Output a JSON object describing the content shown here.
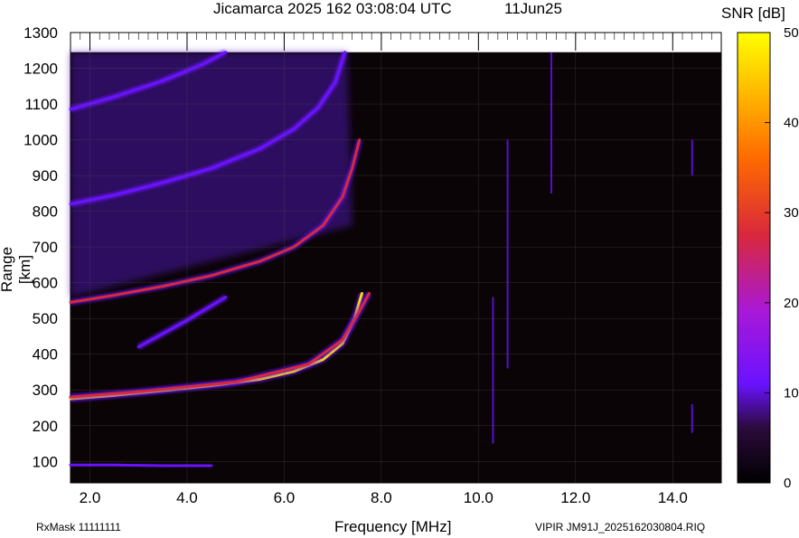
{
  "header": {
    "title": "Jicamarca 2025 162 03:08:04 UTC",
    "date": "11Jun25",
    "colorbar_title": "SNR [dB]"
  },
  "footer": {
    "rxmask": "RxMask 11111111",
    "file": "VIPIR  JM91J_2025162030804.RIQ"
  },
  "colors": {
    "background": "#0b0406",
    "trace_low": "#6a12ff",
    "trace_mid": "#d8283c",
    "trace_high": "#ffe000"
  },
  "chart_data": {
    "type": "heatmap",
    "xlabel": "Frequency [MHz]",
    "ylabel": "Range [km]",
    "xlim": [
      1.6,
      15.0
    ],
    "ylim": [
      40,
      1300
    ],
    "x_ticks": [
      "2.0",
      "4.0",
      "6.0",
      "8.0",
      "10.0",
      "12.0",
      "14.0"
    ],
    "y_ticks": [
      "100",
      "200",
      "300",
      "400",
      "500",
      "600",
      "700",
      "800",
      "900",
      "1000",
      "1100",
      "1200",
      "1300"
    ],
    "data_range_max": 1245,
    "colorbar": {
      "min": 0,
      "max": 50,
      "ticks": [
        "0",
        "10",
        "20",
        "30",
        "40",
        "50"
      ],
      "unit": "dB"
    },
    "traces": [
      {
        "points": [
          [
            1.6,
            275
          ],
          [
            2.5,
            285
          ],
          [
            3.5,
            298
          ],
          [
            4.5,
            312
          ],
          [
            5.5,
            330
          ],
          [
            6.2,
            352
          ],
          [
            6.8,
            385
          ],
          [
            7.2,
            430
          ],
          [
            7.45,
            500
          ],
          [
            7.6,
            570
          ]
        ],
        "snr": 38
      },
      {
        "points": [
          [
            1.6,
            280
          ],
          [
            3.0,
            295
          ],
          [
            5.0,
            322
          ],
          [
            6.5,
            372
          ],
          [
            7.2,
            440
          ],
          [
            7.55,
            520
          ],
          [
            7.75,
            570
          ]
        ],
        "snr": 25
      },
      {
        "points": [
          [
            1.6,
            545
          ],
          [
            2.5,
            565
          ],
          [
            3.5,
            590
          ],
          [
            4.5,
            620
          ],
          [
            5.5,
            660
          ],
          [
            6.2,
            700
          ],
          [
            6.8,
            760
          ],
          [
            7.2,
            840
          ],
          [
            7.4,
            920
          ],
          [
            7.55,
            1000
          ]
        ],
        "snr": 30
      },
      {
        "points": [
          [
            1.6,
            820
          ],
          [
            2.5,
            845
          ],
          [
            3.5,
            880
          ],
          [
            4.5,
            920
          ],
          [
            5.5,
            975
          ],
          [
            6.2,
            1030
          ],
          [
            6.7,
            1090
          ],
          [
            7.05,
            1160
          ],
          [
            7.25,
            1245
          ]
        ],
        "snr": 22
      },
      {
        "points": [
          [
            1.6,
            1085
          ],
          [
            2.5,
            1120
          ],
          [
            3.5,
            1165
          ],
          [
            4.3,
            1210
          ],
          [
            4.8,
            1245
          ]
        ],
        "snr": 20
      },
      {
        "points": [
          [
            3.0,
            420
          ],
          [
            4.0,
            495
          ],
          [
            4.8,
            560
          ]
        ],
        "snr": 12
      },
      {
        "points": [
          [
            1.6,
            90
          ],
          [
            2.5,
            90
          ],
          [
            3.5,
            88
          ],
          [
            4.5,
            88
          ]
        ],
        "snr": 12
      }
    ],
    "vertical_lines": [
      {
        "x": 10.3,
        "y": [
          150,
          560
        ],
        "snr": 14
      },
      {
        "x": 11.5,
        "y": [
          850,
          1245
        ],
        "snr": 15
      },
      {
        "x": 10.6,
        "y": [
          360,
          1000
        ],
        "snr": 8
      },
      {
        "x": 14.4,
        "y": [
          180,
          260
        ],
        "snr": 10
      },
      {
        "x": 14.4,
        "y": [
          900,
          1000
        ],
        "snr": 10
      }
    ]
  }
}
